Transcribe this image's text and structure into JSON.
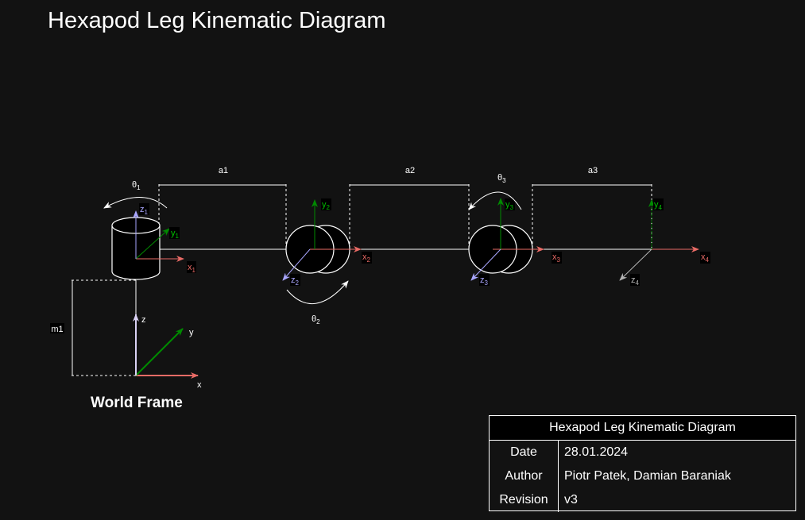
{
  "title": "Hexapod Leg Kinematic Diagram",
  "world_frame": {
    "label": "World Frame",
    "x": "x",
    "y": "y",
    "z": "z"
  },
  "dimensions": {
    "a1": "a1",
    "a2": "a2",
    "a3": "a3",
    "m1": "m1"
  },
  "angles": [
    {
      "symbol": "θ",
      "index": "1"
    },
    {
      "symbol": "θ",
      "index": "2"
    },
    {
      "symbol": "θ",
      "index": "3"
    }
  ],
  "frames": [
    {
      "x": "x",
      "y": "y",
      "z": "z",
      "index": "1"
    },
    {
      "x": "x",
      "y": "y",
      "z": "z",
      "index": "2"
    },
    {
      "x": "x",
      "y": "y",
      "z": "z",
      "index": "3"
    },
    {
      "x": "x",
      "y": "y",
      "z": "z",
      "index": "4"
    }
  ],
  "title_block": {
    "header": "Hexapod Leg Kinematic Diagram",
    "rows": [
      {
        "key": "Date",
        "value": "28.01.2024"
      },
      {
        "key": "Author",
        "value": "Piotr Patek, Damian Baraniak"
      },
      {
        "key": "Revision",
        "value": "v3"
      }
    ]
  },
  "colors": {
    "background": "#121212",
    "x_axis": "#ea6b66",
    "y_axis": "#008a00",
    "z_axis": "#a9a6ff",
    "z_axis_world": "#dad2f5",
    "z4_axis": "#b3b3b3",
    "line": "#ffffff"
  }
}
